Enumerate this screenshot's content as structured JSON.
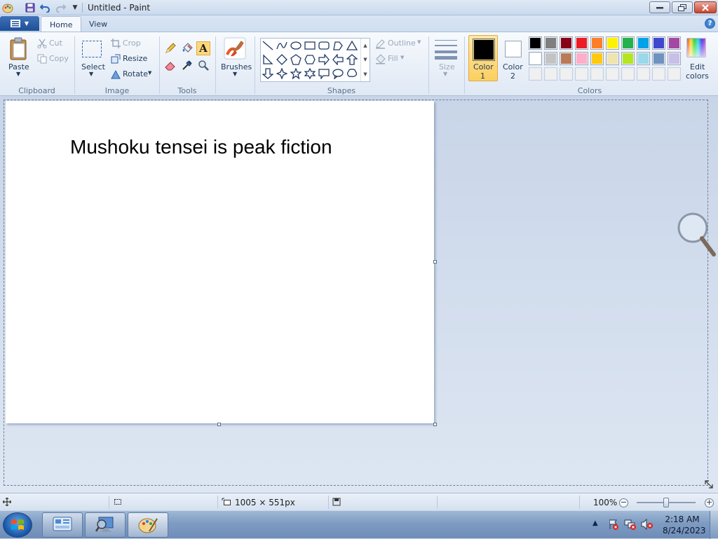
{
  "window": {
    "title": "Untitled - Paint"
  },
  "tabs": [
    {
      "label": "Home"
    },
    {
      "label": "View"
    }
  ],
  "ribbon": {
    "clipboard": {
      "group_label": "Clipboard",
      "paste_label": "Paste",
      "cut_label": "Cut",
      "copy_label": "Copy"
    },
    "image": {
      "group_label": "Image",
      "select_label": "Select",
      "crop_label": "Crop",
      "resize_label": "Resize",
      "rotate_label": "Rotate"
    },
    "tools": {
      "group_label": "Tools",
      "active_tool": "text-tool"
    },
    "brushes": {
      "label": "Brushes"
    },
    "shapes": {
      "group_label": "Shapes",
      "outline_label": "Outline",
      "fill_label": "Fill"
    },
    "size": {
      "label": "Size"
    },
    "colors": {
      "group_label": "Colors",
      "color1_label_line1": "Color",
      "color1_label_line2": "1",
      "color2_label_line1": "Color",
      "color2_label_line2": "2",
      "edit_colors_line1": "Edit",
      "edit_colors_line2": "colors",
      "color1_value": "#000000",
      "color2_value": "#ffffff",
      "palette_row1": [
        "#000000",
        "#7f7f7f",
        "#880015",
        "#ed1c24",
        "#ff7f27",
        "#fff200",
        "#22b14c",
        "#00a2e8",
        "#3f48cc",
        "#a349a4"
      ],
      "palette_row2": [
        "#ffffff",
        "#c3c3c3",
        "#b97a57",
        "#ffaec9",
        "#ffc90e",
        "#efe4b0",
        "#b5e61d",
        "#99d9ea",
        "#7092be",
        "#c8bfe7"
      ],
      "palette_row3": [
        "#f0f0f0",
        "#f0f0f0",
        "#f0f0f0",
        "#f0f0f0",
        "#f0f0f0",
        "#f0f0f0",
        "#f0f0f0",
        "#f0f0f0",
        "#f0f0f0",
        "#f0f0f0"
      ]
    }
  },
  "canvas": {
    "text": "Mushoku tensei is peak fiction",
    "background": "#ffffff"
  },
  "statusbar": {
    "canvas_size": "1005 × 551px",
    "zoom": "100%"
  },
  "taskbar": {
    "time": "2:18 AM",
    "date": "8/24/2023"
  }
}
